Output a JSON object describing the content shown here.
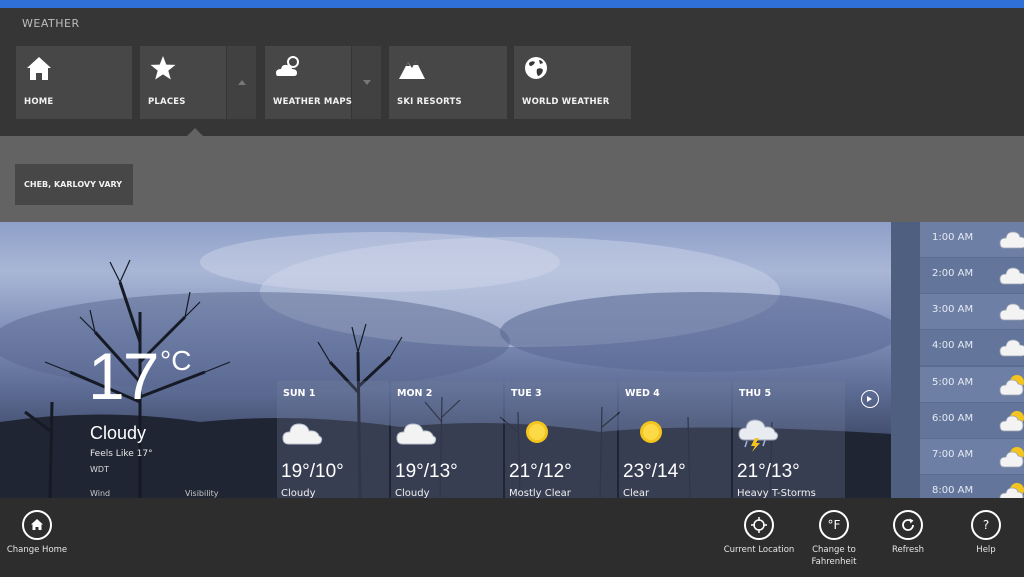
{
  "app": {
    "title": "WEATHER",
    "accent_color": "#2e6fd8"
  },
  "nav": {
    "tiles": [
      {
        "label": "HOME",
        "icon": "home-icon"
      },
      {
        "label": "PLACES",
        "icon": "star-icon"
      },
      {
        "label": "WEATHER MAPS",
        "icon": "weather-map-icon"
      },
      {
        "label": "SKI RESORTS",
        "icon": "mountain-icon"
      },
      {
        "label": "WORLD WEATHER",
        "icon": "globe-icon"
      }
    ],
    "selected": "PLACES"
  },
  "places": {
    "items": [
      {
        "label": "CHEB, KARLOVY VARY"
      }
    ]
  },
  "current": {
    "temp": "17",
    "unit": "°C",
    "condition": "Cloudy",
    "feels_like": "Feels Like 17°",
    "source": "WDT",
    "wind_label": "Wind",
    "visibility_label": "Visibility"
  },
  "forecast": [
    {
      "day": "SUN 1",
      "temps": "19°/10°",
      "condition": "Cloudy",
      "icon": "cloud-icon"
    },
    {
      "day": "MON 2",
      "temps": "19°/13°",
      "condition": "Cloudy",
      "icon": "cloud-icon"
    },
    {
      "day": "TUE 3",
      "temps": "21°/12°",
      "condition": "Mostly Clear",
      "icon": "sun-icon"
    },
    {
      "day": "WED 4",
      "temps": "23°/14°",
      "condition": "Clear",
      "icon": "sun-icon"
    },
    {
      "day": "THU 5",
      "temps": "21°/13°",
      "condition": "Heavy T-Storms",
      "icon": "thunderstorm-icon"
    }
  ],
  "hourly": [
    {
      "time": "1:00 AM",
      "icon": "cloud-icon"
    },
    {
      "time": "2:00 AM",
      "icon": "cloud-icon"
    },
    {
      "time": "3:00 AM",
      "icon": "cloud-icon"
    },
    {
      "time": "4:00 AM",
      "icon": "cloud-icon"
    },
    {
      "time": "5:00 AM",
      "icon": "partly-sunny-icon"
    },
    {
      "time": "6:00 AM",
      "icon": "partly-sunny-icon"
    },
    {
      "time": "7:00 AM",
      "icon": "partly-sunny-icon"
    },
    {
      "time": "8:00 AM",
      "icon": "partly-sunny-icon"
    }
  ],
  "appbar": {
    "change_home": "Change Home",
    "current_location": "Current Location",
    "change_to_fahrenheit": "Change to Fahrenheit",
    "fahrenheit_glyph": "°F",
    "refresh": "Refresh",
    "help": "Help",
    "help_glyph": "?"
  }
}
